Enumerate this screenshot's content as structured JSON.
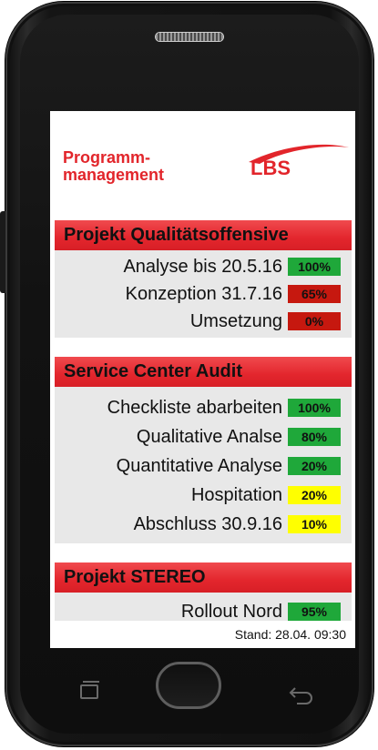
{
  "brand": {
    "title_line1": "Programm-",
    "title_line2": "management",
    "logo_text": "LBS"
  },
  "sections": [
    {
      "title": "Projekt Qualitätsoffensive",
      "items": [
        {
          "label": "Analyse bis 20.5.16",
          "value": "100%",
          "color": "#1fa83a"
        },
        {
          "label": "Konzeption 31.7.16",
          "value": "65%",
          "color": "#c6180f"
        },
        {
          "label": "Umsetzung",
          "value": "0%",
          "color": "#c6180f"
        }
      ]
    },
    {
      "title": "Service Center Audit",
      "items": [
        {
          "label": "Checkliste abarbeiten",
          "value": "100%",
          "color": "#1fa83a"
        },
        {
          "label": "Qualitative Analse",
          "value": "80%",
          "color": "#1fa83a"
        },
        {
          "label": "Quantitative Analyse",
          "value": "20%",
          "color": "#1fa83a"
        },
        {
          "label": "Hospitation",
          "value": "20%",
          "color": "#ffff00"
        },
        {
          "label": "Abschluss 30.9.16",
          "value": "10%",
          "color": "#ffff00"
        }
      ]
    },
    {
      "title": "Projekt STEREO",
      "items": [
        {
          "label": "Rollout Nord",
          "value": "95%",
          "color": "#1fa83a"
        }
      ]
    }
  ],
  "footer": {
    "status": "Stand: 28.04. 09:30"
  },
  "device": {
    "nav_icons": [
      "recent-apps-icon",
      "home-button",
      "back-icon"
    ]
  }
}
